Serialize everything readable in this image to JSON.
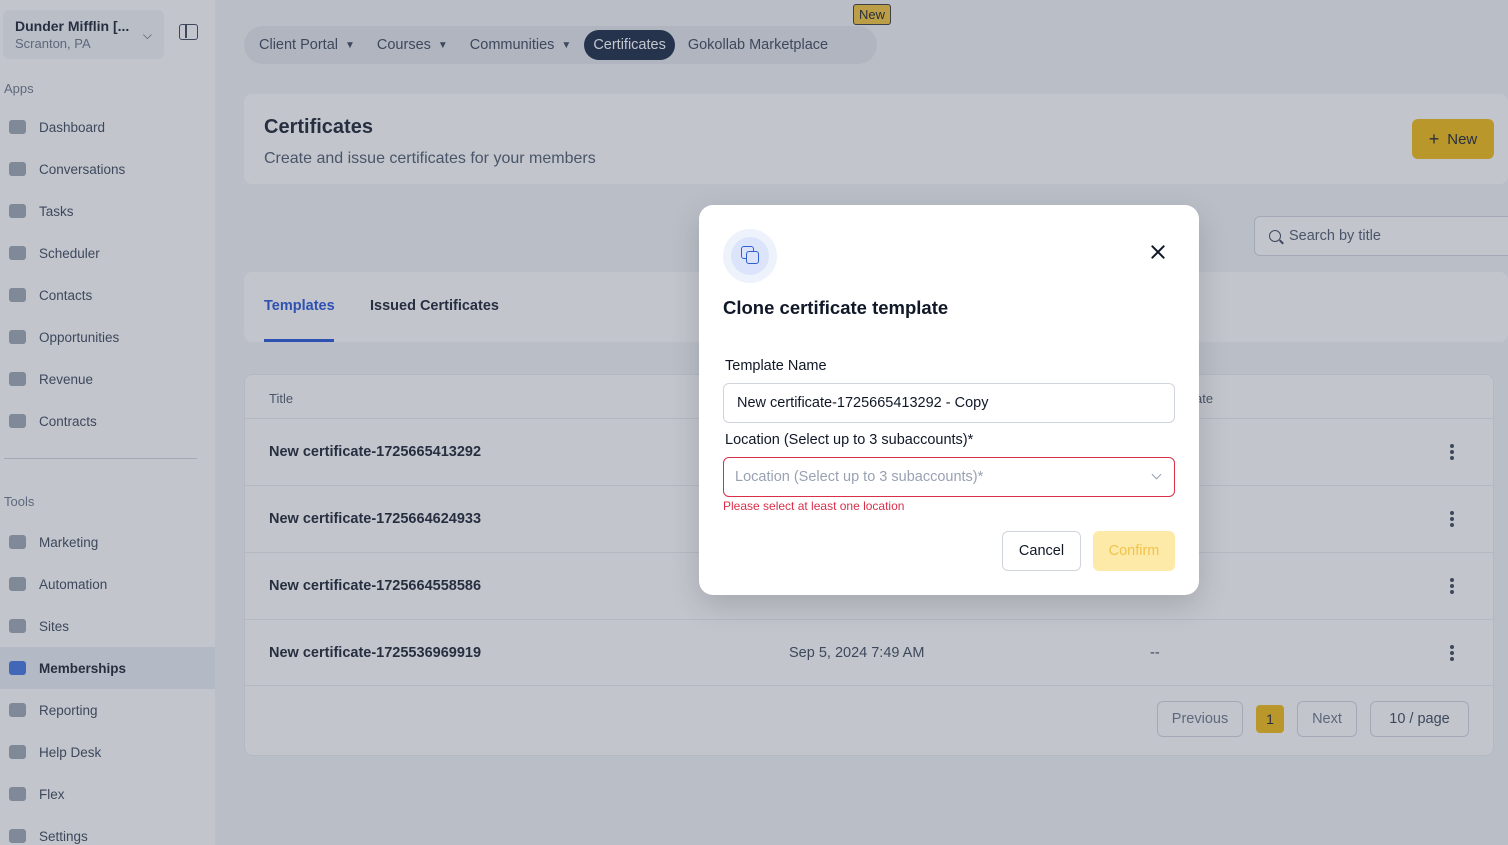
{
  "account": {
    "name": "Dunder Mifflin [...",
    "location": "Scranton, PA"
  },
  "sidebar": {
    "apps_label": "Apps",
    "tools_label": "Tools",
    "apps": [
      {
        "label": "Dashboard"
      },
      {
        "label": "Conversations"
      },
      {
        "label": "Tasks"
      },
      {
        "label": "Scheduler"
      },
      {
        "label": "Contacts"
      },
      {
        "label": "Opportunities"
      },
      {
        "label": "Revenue"
      },
      {
        "label": "Contracts"
      }
    ],
    "tools": [
      {
        "label": "Marketing"
      },
      {
        "label": "Automation"
      },
      {
        "label": "Sites"
      },
      {
        "label": "Memberships"
      },
      {
        "label": "Reporting"
      },
      {
        "label": "Help Desk"
      },
      {
        "label": "Flex"
      },
      {
        "label": "Settings"
      }
    ]
  },
  "topnav": {
    "tabs": [
      {
        "label": "Client Portal"
      },
      {
        "label": "Courses"
      },
      {
        "label": "Communities"
      },
      {
        "label": "Certificates"
      },
      {
        "label": "Gokollab Marketplace"
      }
    ],
    "new_badge": "New"
  },
  "page": {
    "title": "Certificates",
    "subtitle": "Create and issue certificates for your members",
    "new_button": "New",
    "search_placeholder": "Search by title",
    "tabs": [
      {
        "label": "Templates"
      },
      {
        "label": "Issued Certificates"
      }
    ]
  },
  "table": {
    "headers": {
      "title": "Title",
      "updated_partial": "ate"
    },
    "rows": [
      {
        "title": "New certificate-1725665413292",
        "created": "",
        "updated": ""
      },
      {
        "title": "New certificate-1725664624933",
        "created": "",
        "updated": ""
      },
      {
        "title": "New certificate-1725664558586",
        "created": "",
        "updated": ""
      },
      {
        "title": "New certificate-1725536969919",
        "created": "Sep 5, 2024 7:49 AM",
        "updated": "--"
      }
    ],
    "pagination": {
      "previous": "Previous",
      "current_page": "1",
      "next": "Next",
      "page_size": "10 / page"
    }
  },
  "modal": {
    "title": "Clone certificate template",
    "template_name_label": "Template Name",
    "template_name_value": "New certificate-1725665413292 - Copy",
    "location_label": "Location (Select up to 3 subaccounts)*",
    "location_placeholder": "Location (Select up to 3 subaccounts)*",
    "error": "Please select at least one location",
    "cancel": "Cancel",
    "confirm": "Confirm"
  }
}
